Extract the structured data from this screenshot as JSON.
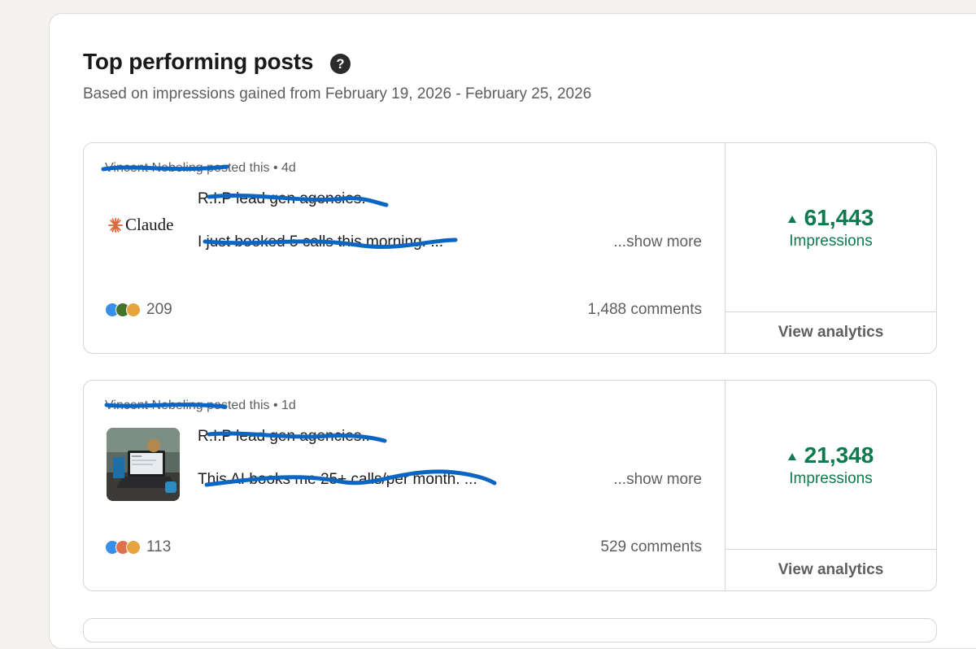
{
  "header": {
    "title": "Top performing posts",
    "help_icon": "question-circle-icon",
    "subtitle": "Based on impressions gained from February 19, 2026 - February 25, 2026"
  },
  "posts": [
    {
      "author": "Vincent Nebeling",
      "posted_label": "posted this •",
      "age": "4d",
      "thumbnail": "claude-logo",
      "logo_text": "Claude",
      "line1": "R.I.P lead gen agencies.",
      "line2": "I just booked 5 calls this morning. ...",
      "show_more": "...show more",
      "reaction_icons": [
        "like-icon",
        "celebrate-icon",
        "insightful-icon"
      ],
      "reactions": "209",
      "comments": "1,488 comments",
      "impressions": "61,443",
      "impressions_label": "Impressions",
      "analytics_label": "View analytics"
    },
    {
      "author": "Vincent Nebeling",
      "posted_label": "posted this •",
      "age": "1d",
      "thumbnail": "laptop-photo",
      "line1": "R.I.P lead gen agencies..",
      "line2": "This AI books me 25+ calls/per month. ...",
      "show_more": "...show more",
      "reaction_icons": [
        "like-icon",
        "love-icon",
        "insightful-icon"
      ],
      "reactions": "113",
      "comments": "529 comments",
      "impressions": "21,348",
      "impressions_label": "Impressions",
      "analytics_label": "View analytics"
    }
  ],
  "colors": {
    "impressions": "#0f7a4f",
    "scribble": "#0a66c2",
    "background": "#f3f2ef"
  }
}
